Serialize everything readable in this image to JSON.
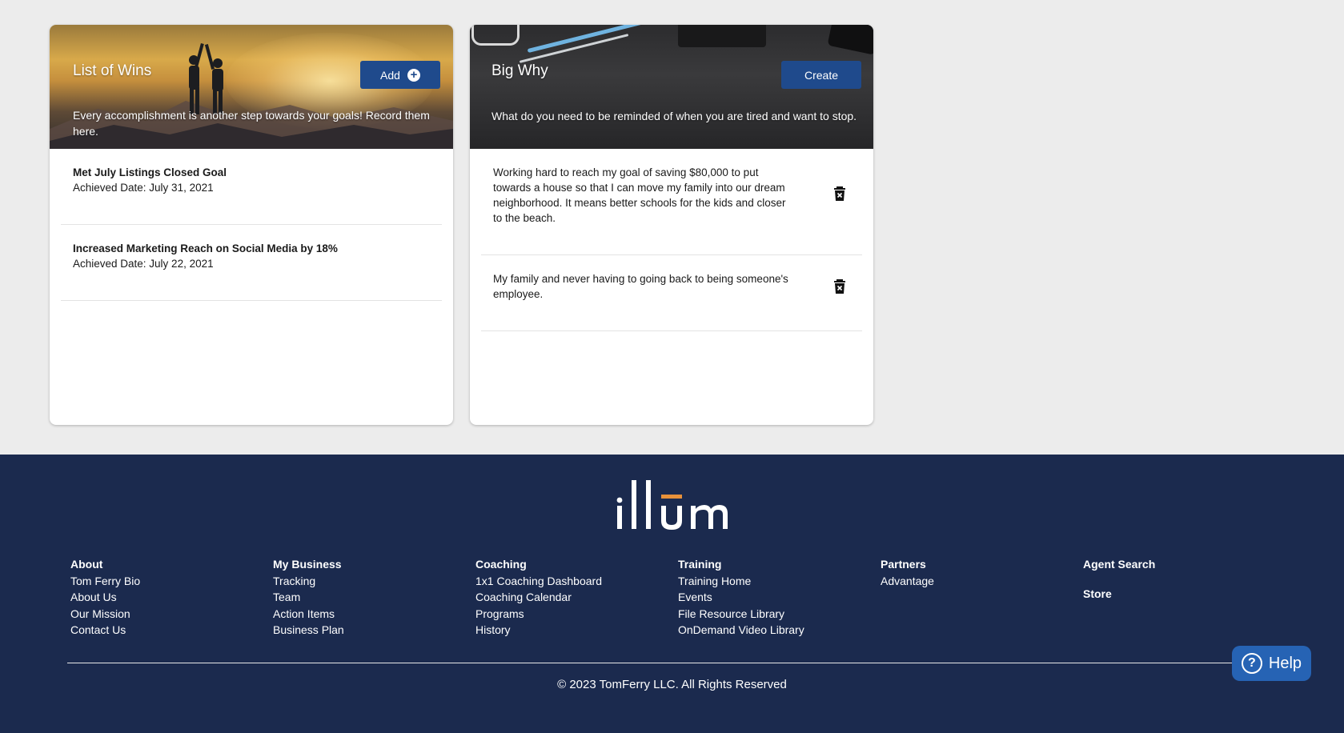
{
  "wins_card": {
    "title": "List of Wins",
    "add_label": "Add",
    "description": "Every accomplishment is another step towards your goals! Record them here.",
    "items": [
      {
        "title": "Met July Listings Closed Goal",
        "date": "Achieved Date: July 31, 2021"
      },
      {
        "title": "Increased Marketing Reach on Social Media by 18%",
        "date": "Achieved Date: July 22, 2021"
      }
    ]
  },
  "why_card": {
    "title": "Big Why",
    "create_label": "Create",
    "description": "What do you need to be reminded of when you are tired and want to stop.",
    "items": [
      {
        "text": "Working hard to reach my goal of saving $80,000 to put towards a house so that I can move my family into our dream neighborhood. It means better schools for the kids and closer to the beach."
      },
      {
        "text": "My family and never having to going back to being someone's employee."
      }
    ]
  },
  "footer": {
    "logo_alt": "illum",
    "columns": [
      {
        "heading": "About",
        "links": [
          "Tom Ferry Bio",
          "About Us",
          "Our Mission",
          "Contact Us"
        ]
      },
      {
        "heading": "My Business",
        "links": [
          "Tracking",
          "Team",
          "Action Items",
          "Business Plan"
        ]
      },
      {
        "heading": "Coaching",
        "links": [
          "1x1 Coaching Dashboard",
          "Coaching Calendar",
          "Programs",
          "History"
        ]
      },
      {
        "heading": "Training",
        "links": [
          "Training Home",
          "Events",
          "File Resource Library",
          "OnDemand Video Library"
        ]
      },
      {
        "heading": "Partners",
        "links": [
          "Advantage"
        ]
      },
      {
        "heading": "Agent Search",
        "links": [
          "Store"
        ]
      }
    ],
    "copyright": "© 2023 TomFerry LLC. All Rights Reserved"
  },
  "help": {
    "label": "Help"
  },
  "colors": {
    "accent": "#1f4a8c",
    "footer_bg": "#1b2a4e",
    "logo_accent": "#e8913a",
    "help_bg": "#2663b4"
  }
}
